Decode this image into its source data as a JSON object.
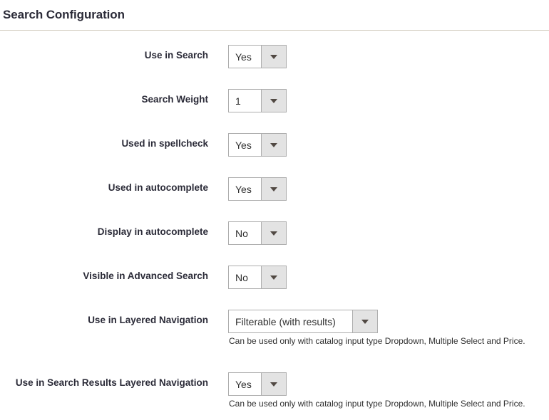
{
  "section": {
    "title": "Search Configuration"
  },
  "fields": [
    {
      "label": "Use in Search",
      "value": "Yes",
      "width": "short",
      "note": null
    },
    {
      "label": "Search Weight",
      "value": "1",
      "width": "short",
      "note": null
    },
    {
      "label": "Used in spellcheck",
      "value": "Yes",
      "width": "short",
      "note": null
    },
    {
      "label": "Used in autocomplete",
      "value": "Yes",
      "width": "short",
      "note": null
    },
    {
      "label": "Display in autocomplete",
      "value": "No",
      "width": "short",
      "note": null
    },
    {
      "label": "Visible in Advanced Search",
      "value": "No",
      "width": "short",
      "note": null
    },
    {
      "label": "Use in Layered Navigation",
      "value": "Filterable (with results)",
      "width": "long",
      "note": "Can be used only with catalog input type Dropdown, Multiple Select and Price."
    },
    {
      "label": "Use in Search Results Layered Navigation",
      "value": "Yes",
      "width": "short",
      "note": "Can be used only with catalog input type Dropdown, Multiple Select and Price."
    }
  ],
  "icons": {
    "dropdown_caret": "chevron-down-icon"
  },
  "colors": {
    "title_text": "#2b2b38",
    "body_text": "#303030",
    "divider": "#d1cbbe",
    "select_border": "#adadad",
    "select_button_bg": "#e3e3e3",
    "caret": "#514943",
    "background": "#ffffff"
  }
}
